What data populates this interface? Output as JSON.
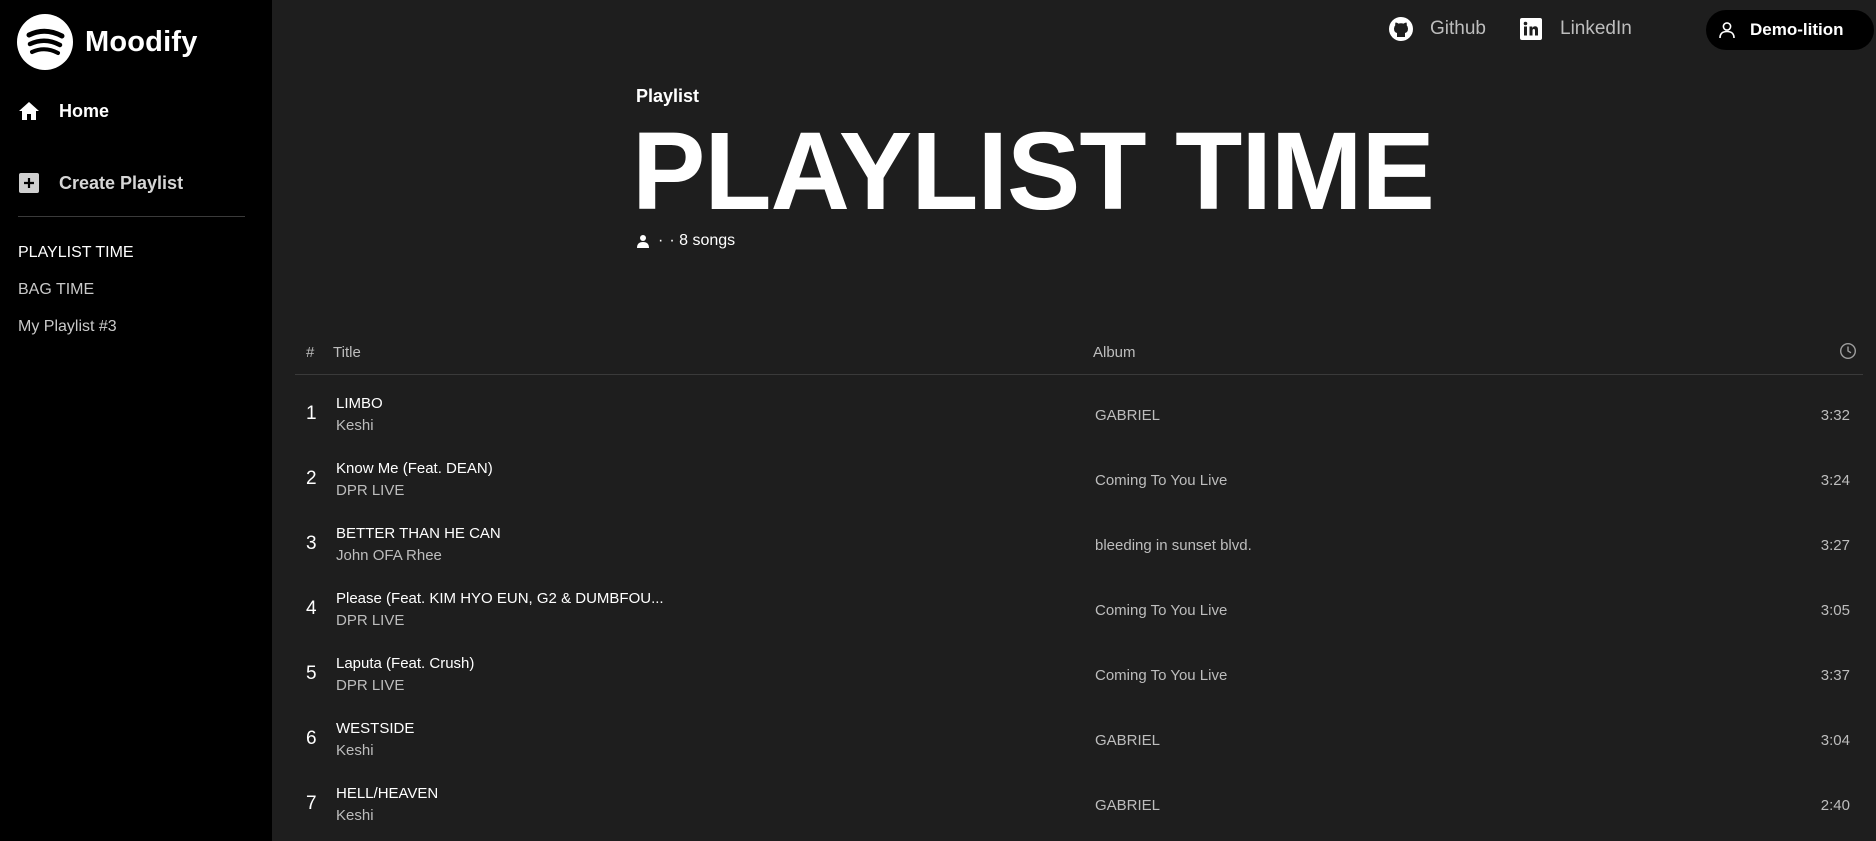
{
  "app": {
    "name": "Moodify"
  },
  "sidebar": {
    "nav": [
      {
        "label": "Home",
        "icon": "home-icon"
      },
      {
        "label": "Create Playlist",
        "icon": "plus-square-icon"
      }
    ],
    "playlists": [
      {
        "label": "PLAYLIST TIME",
        "active": true
      },
      {
        "label": "BAG TIME",
        "active": false
      },
      {
        "label": "My Playlist #3",
        "active": false
      }
    ]
  },
  "topbar": {
    "github_label": "Github",
    "linkedin_label": "LinkedIn",
    "user_label": "Demo-lition"
  },
  "playlist": {
    "type_label": "Playlist",
    "title": "PLAYLIST TIME",
    "meta_dot": "·",
    "meta_songs": "· 8 songs"
  },
  "table": {
    "headers": {
      "num": "#",
      "title": "Title",
      "album": "Album",
      "time_icon": "clock-icon"
    },
    "rows": [
      {
        "num": "1",
        "title": "LIMBO",
        "artist": "Keshi",
        "album": "GABRIEL",
        "duration": "3:32"
      },
      {
        "num": "2",
        "title": "Know Me (Feat. DEAN)",
        "artist": "DPR LIVE",
        "album": "Coming To You Live",
        "duration": "3:24"
      },
      {
        "num": "3",
        "title": "BETTER THAN HE CAN",
        "artist": "John OFA Rhee",
        "album": "bleeding in sunset blvd.",
        "duration": "3:27"
      },
      {
        "num": "4",
        "title": "Please (Feat. KIM HYO EUN, G2 & DUMBFOU...",
        "artist": "DPR LIVE",
        "album": "Coming To You Live",
        "duration": "3:05"
      },
      {
        "num": "5",
        "title": "Laputa (Feat. Crush)",
        "artist": "DPR LIVE",
        "album": "Coming To You Live",
        "duration": "3:37"
      },
      {
        "num": "6",
        "title": "WESTSIDE",
        "artist": "Keshi",
        "album": "GABRIEL",
        "duration": "3:04"
      },
      {
        "num": "7",
        "title": "HELL/HEAVEN",
        "artist": "Keshi",
        "album": "GABRIEL",
        "duration": "2:40"
      }
    ]
  }
}
